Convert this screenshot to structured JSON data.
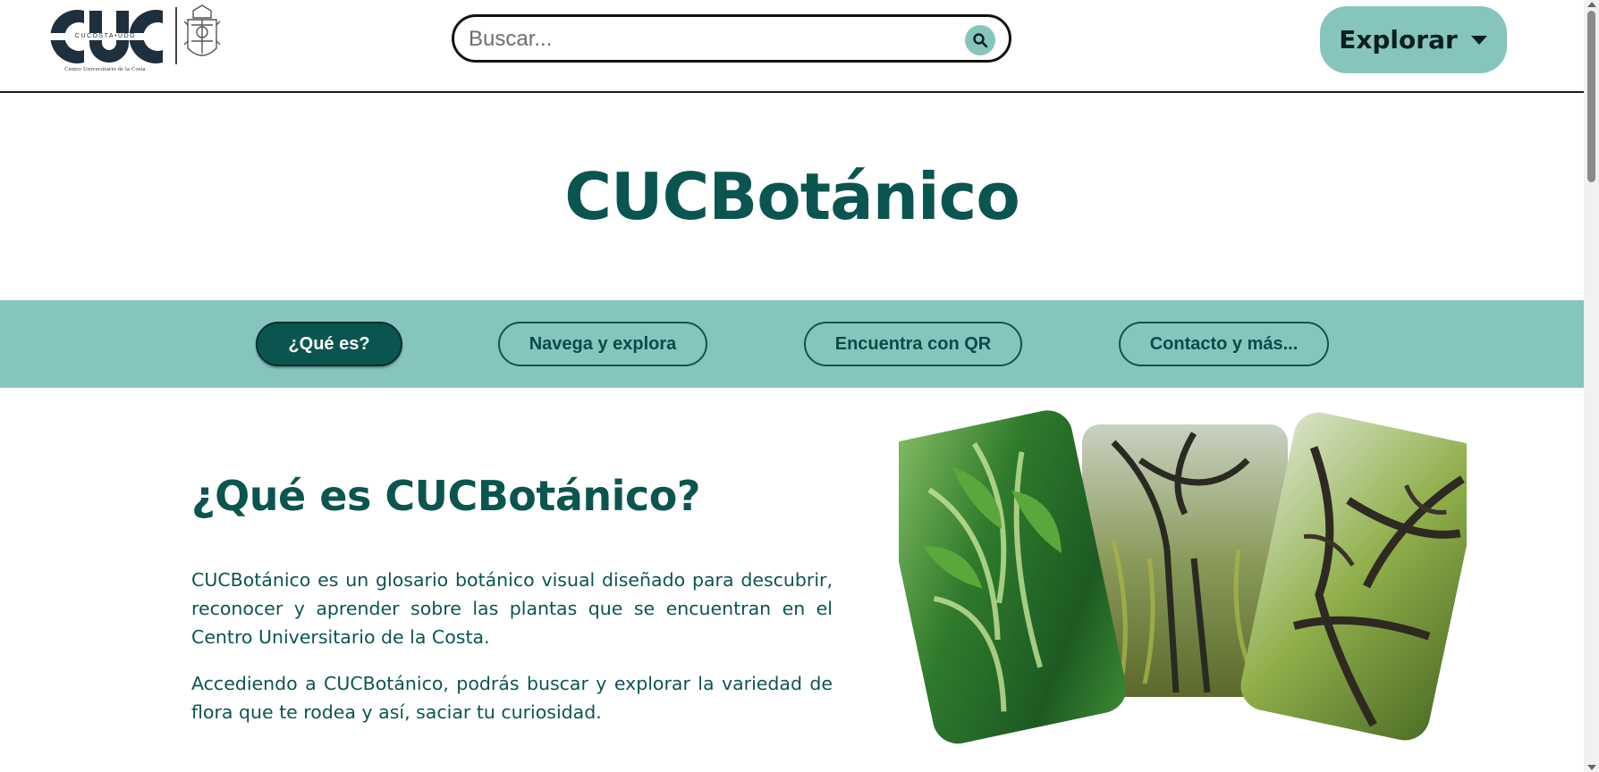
{
  "header": {
    "logo": {
      "lettering": "CUC",
      "band_text": "CUCOSTA•UDG",
      "subtitle": "Centro Universitario de la Costa"
    },
    "search": {
      "placeholder": "Buscar...",
      "value": "",
      "icon": "search-icon"
    },
    "explore_button": {
      "label": "Explorar",
      "icon": "caret-down-icon"
    }
  },
  "hero": {
    "title": "CUCBotánico"
  },
  "nav": {
    "items": [
      {
        "label": "¿Qué es?",
        "active": true
      },
      {
        "label": "Navega y explora",
        "active": false
      },
      {
        "label": "Encuentra con QR",
        "active": false
      },
      {
        "label": "Contacto y más...",
        "active": false
      }
    ]
  },
  "about": {
    "title": "¿Qué es CUCBotánico?",
    "paragraphs": [
      "CUCBotánico es un glosario botánico visual diseñado para descubrir, reconocer y aprender sobre las plantas que se encuentran en el Centro Universitario de la Costa.",
      "Accediendo a CUCBotánico, podrás buscar y explorar la variedad de flora que te rodea y así, saciar tu curiosidad."
    ],
    "collage": [
      "tropical-plants-photo",
      "weeping-tree-photo",
      "tree-canopy-photo"
    ]
  },
  "colors": {
    "primary": "#0b5550",
    "accent": "#86c5bd",
    "background": "#ffffff"
  }
}
